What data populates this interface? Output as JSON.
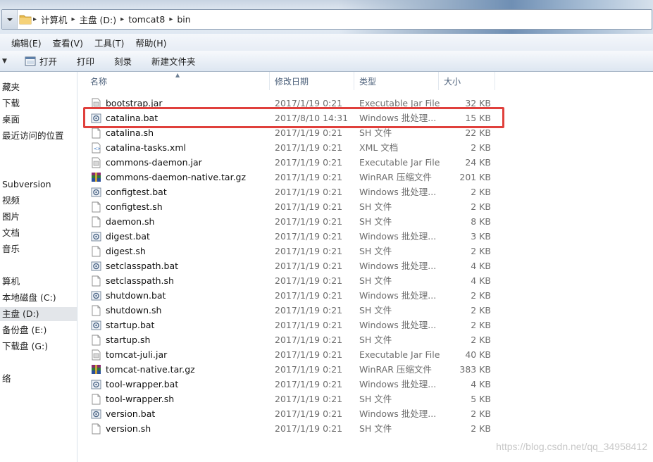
{
  "address_bar": {
    "crumbs": [
      "计算机",
      "主盘 (D:)",
      "tomcat8",
      "bin"
    ]
  },
  "menu": [
    "编辑(E)",
    "查看(V)",
    "工具(T)",
    "帮助(H)"
  ],
  "toolbar": {
    "buttons": [
      "打开",
      "打印",
      "刻录",
      "新建文件夹"
    ]
  },
  "nav": {
    "items": [
      "藏夹",
      "下载",
      "桌面",
      "最近访问的位置",
      "",
      "Subversion",
      "视频",
      "图片",
      "文档",
      "音乐",
      "算机",
      "本地磁盘 (C:)",
      "主盘 (D:)",
      "备份盘 (E:)",
      "下载盘 (G:)",
      "络"
    ],
    "selected": "主盘 (D:)"
  },
  "columns": [
    "名称",
    "修改日期",
    "类型",
    "大小"
  ],
  "files": [
    {
      "name": "bootstrap.jar",
      "date": "2017/1/19 0:21",
      "type": "Executable Jar File",
      "size": "32 KB",
      "icon": "jar-file-icon"
    },
    {
      "name": "catalina.bat",
      "date": "2017/8/10 14:31",
      "type": "Windows 批处理...",
      "size": "15 KB",
      "icon": "batch-file-icon"
    },
    {
      "name": "catalina.sh",
      "date": "2017/1/19 0:21",
      "type": "SH 文件",
      "size": "22 KB",
      "icon": "blank-file-icon"
    },
    {
      "name": "catalina-tasks.xml",
      "date": "2017/1/19 0:21",
      "type": "XML 文档",
      "size": "2 KB",
      "icon": "xml-file-icon"
    },
    {
      "name": "commons-daemon.jar",
      "date": "2017/1/19 0:21",
      "type": "Executable Jar File",
      "size": "24 KB",
      "icon": "jar-file-icon"
    },
    {
      "name": "commons-daemon-native.tar.gz",
      "date": "2017/1/19 0:21",
      "type": "WinRAR 压缩文件",
      "size": "201 KB",
      "icon": "winrar-archive-icon"
    },
    {
      "name": "configtest.bat",
      "date": "2017/1/19 0:21",
      "type": "Windows 批处理...",
      "size": "2 KB",
      "icon": "batch-file-icon"
    },
    {
      "name": "configtest.sh",
      "date": "2017/1/19 0:21",
      "type": "SH 文件",
      "size": "2 KB",
      "icon": "blank-file-icon"
    },
    {
      "name": "daemon.sh",
      "date": "2017/1/19 0:21",
      "type": "SH 文件",
      "size": "8 KB",
      "icon": "blank-file-icon"
    },
    {
      "name": "digest.bat",
      "date": "2017/1/19 0:21",
      "type": "Windows 批处理...",
      "size": "3 KB",
      "icon": "batch-file-icon"
    },
    {
      "name": "digest.sh",
      "date": "2017/1/19 0:21",
      "type": "SH 文件",
      "size": "2 KB",
      "icon": "blank-file-icon"
    },
    {
      "name": "setclasspath.bat",
      "date": "2017/1/19 0:21",
      "type": "Windows 批处理...",
      "size": "4 KB",
      "icon": "batch-file-icon"
    },
    {
      "name": "setclasspath.sh",
      "date": "2017/1/19 0:21",
      "type": "SH 文件",
      "size": "4 KB",
      "icon": "blank-file-icon"
    },
    {
      "name": "shutdown.bat",
      "date": "2017/1/19 0:21",
      "type": "Windows 批处理...",
      "size": "2 KB",
      "icon": "batch-file-icon"
    },
    {
      "name": "shutdown.sh",
      "date": "2017/1/19 0:21",
      "type": "SH 文件",
      "size": "2 KB",
      "icon": "blank-file-icon"
    },
    {
      "name": "startup.bat",
      "date": "2017/1/19 0:21",
      "type": "Windows 批处理...",
      "size": "2 KB",
      "icon": "batch-file-icon"
    },
    {
      "name": "startup.sh",
      "date": "2017/1/19 0:21",
      "type": "SH 文件",
      "size": "2 KB",
      "icon": "blank-file-icon"
    },
    {
      "name": "tomcat-juli.jar",
      "date": "2017/1/19 0:21",
      "type": "Executable Jar File",
      "size": "40 KB",
      "icon": "jar-file-icon"
    },
    {
      "name": "tomcat-native.tar.gz",
      "date": "2017/1/19 0:21",
      "type": "WinRAR 压缩文件",
      "size": "383 KB",
      "icon": "winrar-archive-icon"
    },
    {
      "name": "tool-wrapper.bat",
      "date": "2017/1/19 0:21",
      "type": "Windows 批处理...",
      "size": "4 KB",
      "icon": "batch-file-icon"
    },
    {
      "name": "tool-wrapper.sh",
      "date": "2017/1/19 0:21",
      "type": "SH 文件",
      "size": "5 KB",
      "icon": "blank-file-icon"
    },
    {
      "name": "version.bat",
      "date": "2017/1/19 0:21",
      "type": "Windows 批处理...",
      "size": "2 KB",
      "icon": "batch-file-icon"
    },
    {
      "name": "version.sh",
      "date": "2017/1/19 0:21",
      "type": "SH 文件",
      "size": "2 KB",
      "icon": "blank-file-icon"
    }
  ],
  "highlight": {
    "file": "catalina.bat",
    "color": "#e0403c"
  },
  "watermark": "https://blog.csdn.net/qq_34958412"
}
